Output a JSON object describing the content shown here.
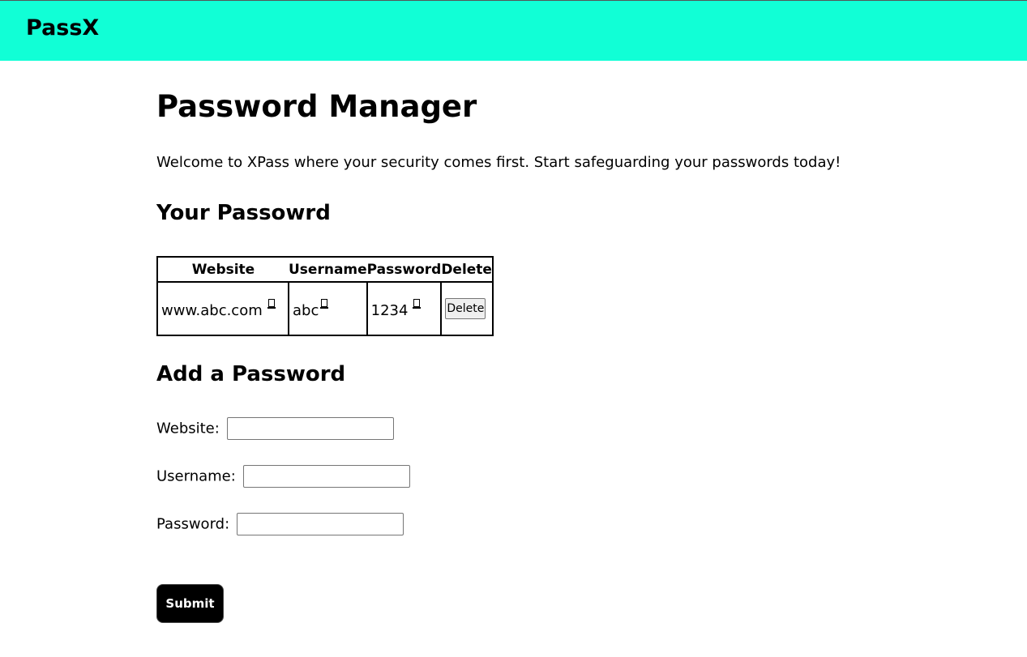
{
  "navbar": {
    "brand": "PassX",
    "background": "#11ffd6"
  },
  "main": {
    "title": "Password Manager",
    "intro": "Welcome to XPass where your security comes first. Start safeguarding your passwords today!"
  },
  "passwords_section": {
    "heading": "Your Passowrd",
    "columns": [
      "Website",
      "Username",
      "Password",
      "Delete"
    ],
    "rows": [
      {
        "website": "www.abc.com",
        "username": "abc",
        "password": "1234",
        "delete_label": "Delete"
      }
    ],
    "copy_icon": "copy-icon"
  },
  "add_section": {
    "heading": "Add a Password",
    "website_label": "Website:",
    "website_value": "",
    "username_label": "Username:",
    "username_value": "",
    "password_label": "Password:",
    "password_value": "",
    "submit_label": "Submit"
  }
}
